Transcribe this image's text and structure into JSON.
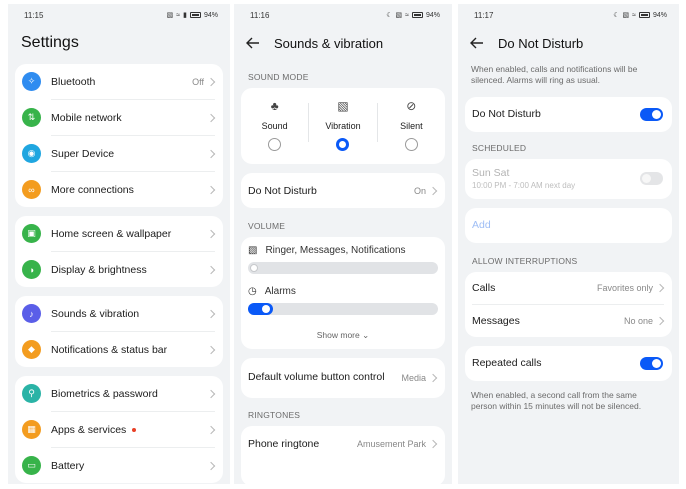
{
  "phone1": {
    "status": {
      "time": "11:15",
      "battery": "94%"
    },
    "title": "Settings",
    "groups": [
      {
        "items": [
          {
            "label": "Bluetooth",
            "value": "Off",
            "icon": "bluetooth-icon",
            "color": "#2f8cf0"
          },
          {
            "label": "Mobile network",
            "value": "",
            "icon": "signal-icon",
            "color": "#37b34a"
          },
          {
            "label": "Super Device",
            "value": "",
            "icon": "super-device-icon",
            "color": "#1fa6e0"
          },
          {
            "label": "More connections",
            "value": "",
            "icon": "link-icon",
            "color": "#f39c1f"
          }
        ]
      },
      {
        "items": [
          {
            "label": "Home screen & wallpaper",
            "value": "",
            "icon": "wallpaper-icon",
            "color": "#37b34a"
          },
          {
            "label": "Display & brightness",
            "value": "",
            "icon": "brightness-icon",
            "color": "#37b34a"
          }
        ]
      },
      {
        "items": [
          {
            "label": "Sounds & vibration",
            "value": "",
            "icon": "speaker-icon",
            "color": "#5a5ee8"
          },
          {
            "label": "Notifications & status bar",
            "value": "",
            "icon": "bell-icon",
            "color": "#f39c1f"
          }
        ]
      },
      {
        "items": [
          {
            "label": "Biometrics & password",
            "value": "",
            "icon": "key-icon",
            "color": "#2ab3a6"
          },
          {
            "label": "Apps & services",
            "value": "",
            "icon": "apps-icon",
            "color": "#f39c1f"
          },
          {
            "label": "Battery",
            "value": "",
            "icon": "battery-icon",
            "color": "#37b34a"
          }
        ]
      }
    ]
  },
  "phone2": {
    "status": {
      "time": "11:16",
      "battery": "94%"
    },
    "title": "Sounds & vibration",
    "sound_mode_header": "SOUND MODE",
    "modes": [
      {
        "label": "Sound",
        "selected": false
      },
      {
        "label": "Vibration",
        "selected": true
      },
      {
        "label": "Silent",
        "selected": false
      }
    ],
    "dnd": {
      "label": "Do Not Disturb",
      "value": "On"
    },
    "volume_header": "VOLUME",
    "volumes": [
      {
        "label": "Ringer, Messages, Notifications",
        "level": 0.0
      },
      {
        "label": "Alarms",
        "level": 0.08
      }
    ],
    "show_more": "Show more",
    "default_volume": {
      "label": "Default volume button control",
      "value": "Media"
    },
    "ringtones_header": "RINGTONES",
    "phone_ringtone": {
      "label": "Phone ringtone",
      "value": "Amusement Park"
    }
  },
  "phone3": {
    "status": {
      "time": "11:17",
      "battery": "94%"
    },
    "title": "Do Not Disturb",
    "description": "When enabled, calls and notifications will be silenced. Alarms will ring as usual.",
    "dnd_label": "Do Not Disturb",
    "dnd_on": true,
    "scheduled_header": "SCHEDULED",
    "schedule": {
      "days": "Sun Sat",
      "time": "10:00 PM - 7:00 AM next day",
      "enabled": false
    },
    "add_label": "Add",
    "allow_header": "ALLOW INTERRUPTIONS",
    "calls": {
      "label": "Calls",
      "value": "Favorites only"
    },
    "messages": {
      "label": "Messages",
      "value": "No one"
    },
    "repeated": {
      "label": "Repeated calls",
      "on": true
    },
    "repeated_desc": "When enabled, a second call from the same person within 15 minutes will not be silenced."
  },
  "colors": {
    "accent": "#0a59f7",
    "background": "#f1f3f5",
    "card": "#ffffff"
  }
}
